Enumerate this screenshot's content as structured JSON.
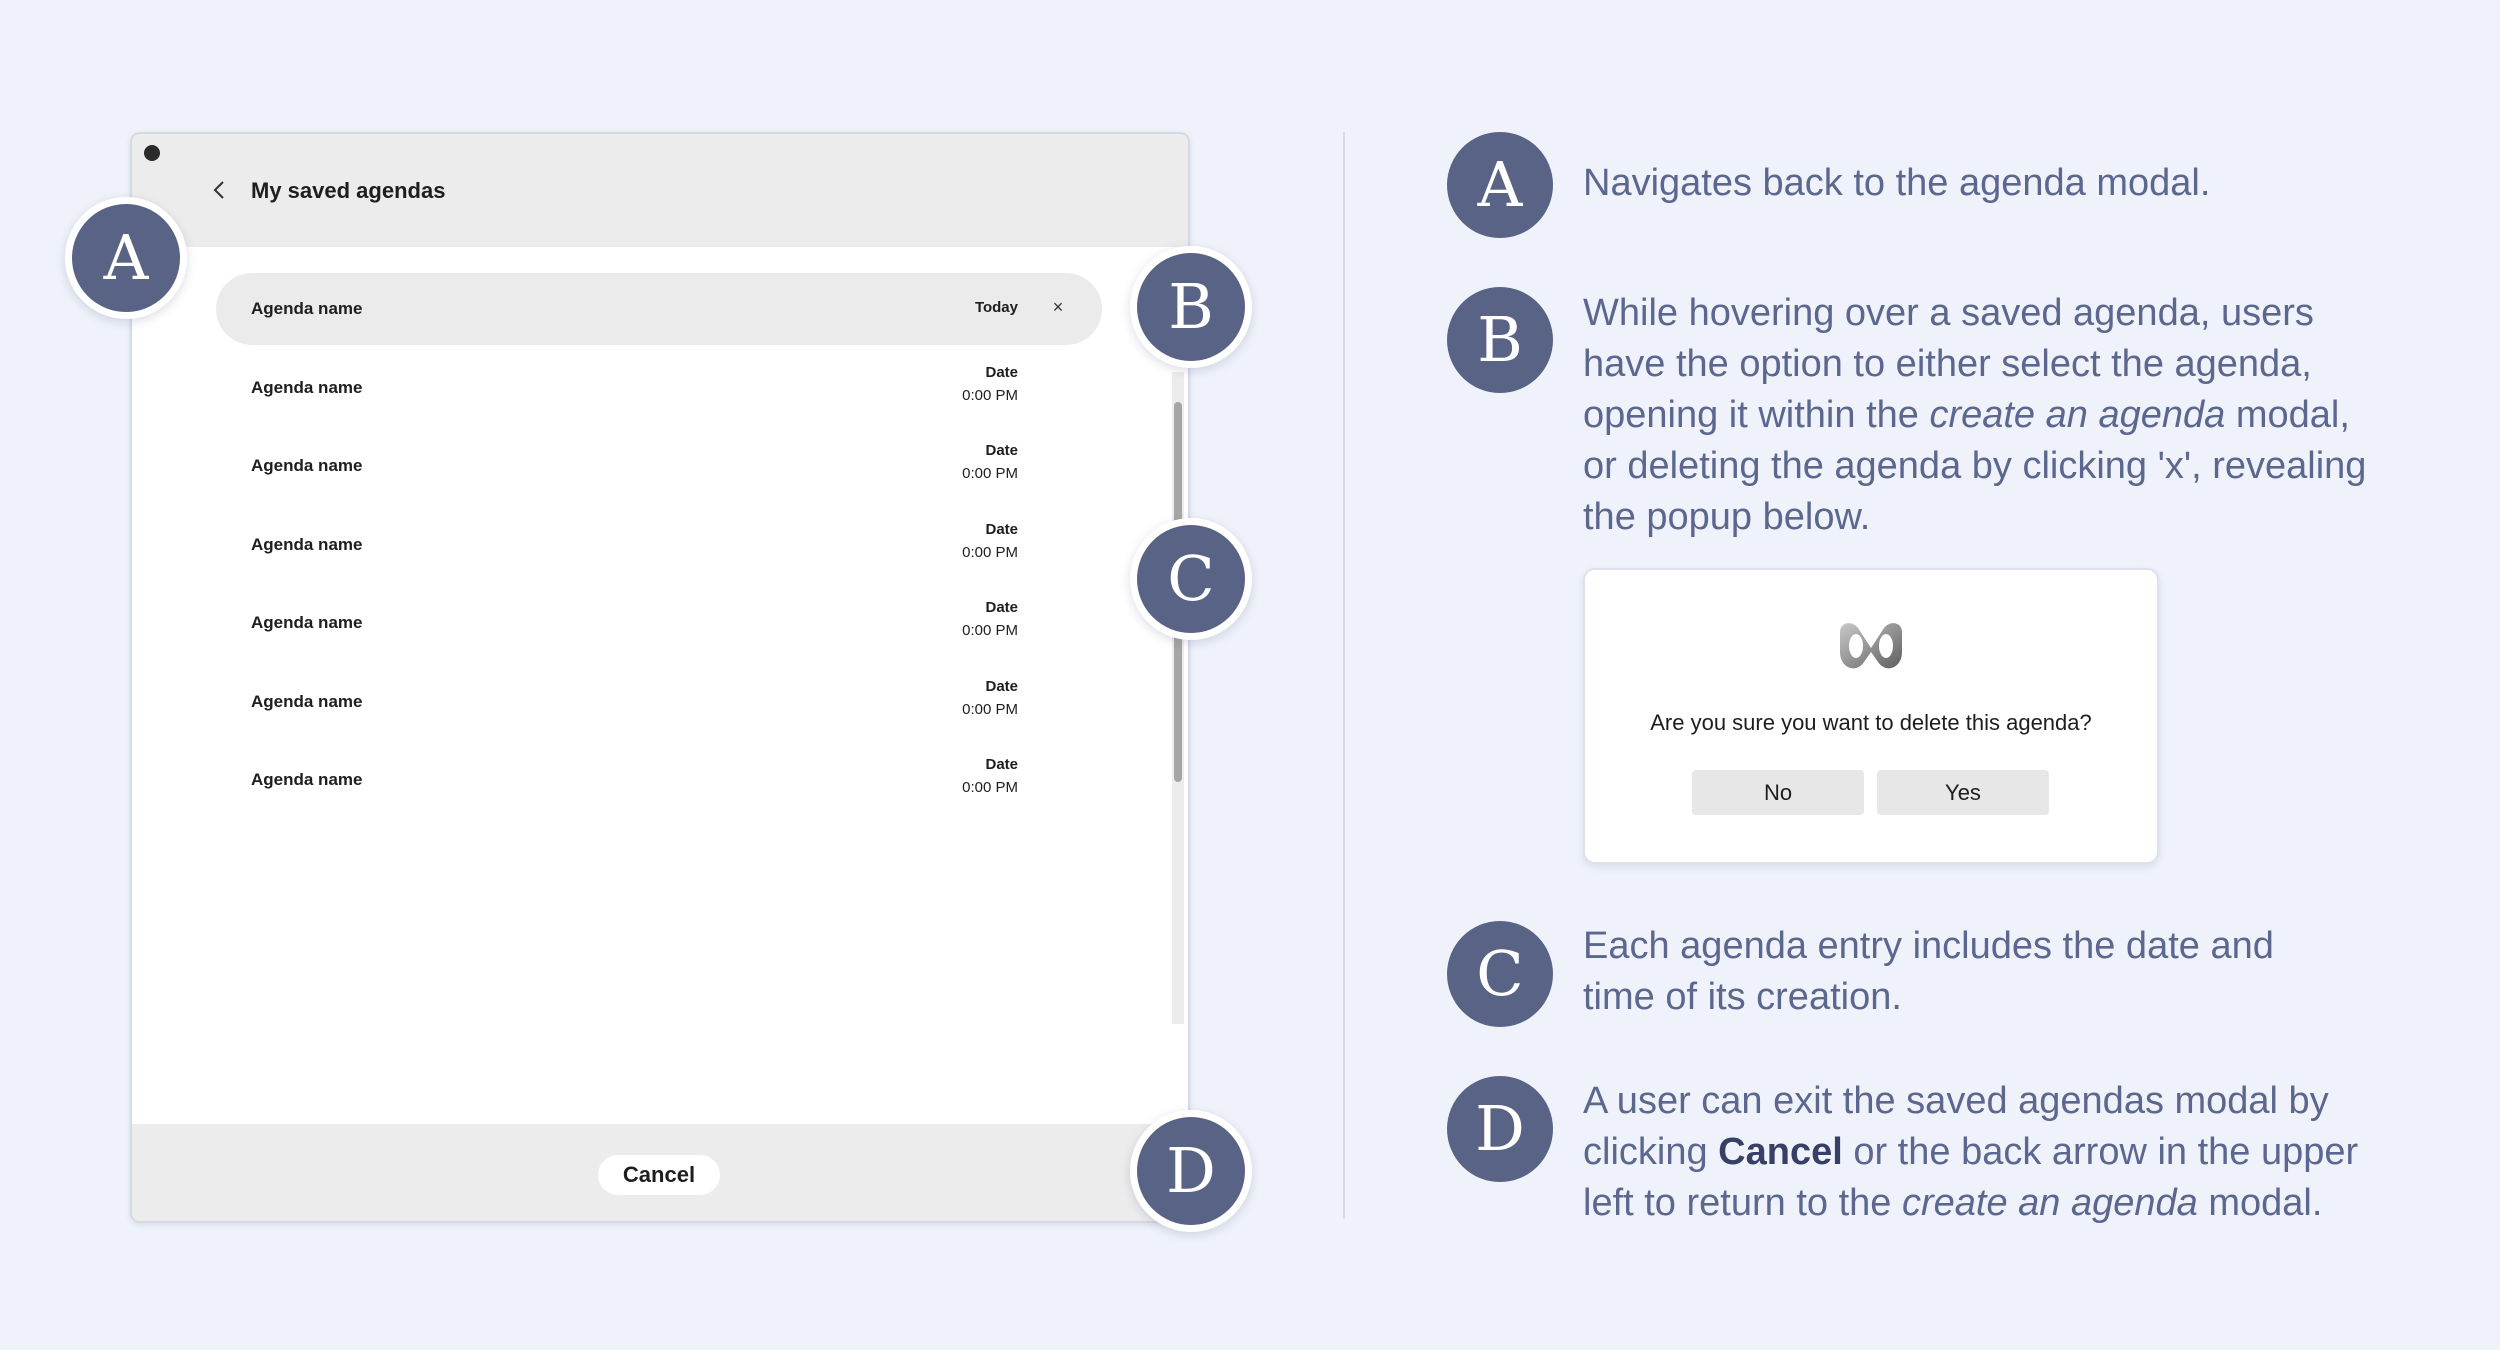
{
  "modal": {
    "title": "My saved agendas",
    "rows": [
      {
        "name": "Agenda name",
        "today": "Today",
        "delete": "×"
      },
      {
        "name": "Agenda name",
        "date": "Date",
        "time": "0:00 PM"
      },
      {
        "name": "Agenda name",
        "date": "Date",
        "time": "0:00 PM"
      },
      {
        "name": "Agenda name",
        "date": "Date",
        "time": "0:00 PM"
      },
      {
        "name": "Agenda name",
        "date": "Date",
        "time": "0:00 PM"
      },
      {
        "name": "Agenda name",
        "date": "Date",
        "time": "0:00 PM"
      },
      {
        "name": "Agenda name",
        "date": "Date",
        "time": "0:00 PM"
      }
    ],
    "cancel_label": "Cancel"
  },
  "callouts": {
    "a": "A",
    "b": "B",
    "c": "C",
    "d": "D"
  },
  "descriptions": {
    "a": "Navigates back to the agenda modal.",
    "b_part1": "While hovering over a saved agenda, users have the option to either select the agenda, opening it within the ",
    "b_em": "create an agenda",
    "b_part2": " modal, or deleting the agenda by clicking 'x', revealing the popup below.",
    "c": "Each agenda entry includes the date and time of its creation.",
    "d_part1": "A user can exit the saved agendas modal by clicking ",
    "d_bold": "Cancel",
    "d_part2": " or the back arrow in the upper left to return to the ",
    "d_em": "create an agenda",
    "d_part3": " modal."
  },
  "popup": {
    "question": "Are you sure you want to delete this agenda?",
    "no_label": "No",
    "yes_label": "Yes"
  },
  "colors": {
    "accent": "#596386",
    "text": "#5c6790",
    "background": "#eff2fa"
  },
  "icons": {
    "back": "chevron-left-icon",
    "delete": "close-icon",
    "logo": "webex-logo-icon"
  }
}
